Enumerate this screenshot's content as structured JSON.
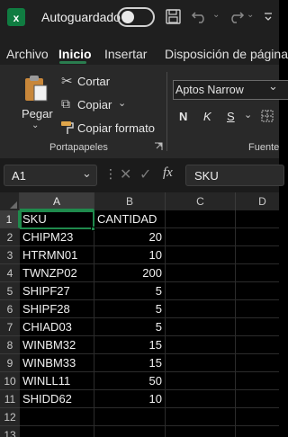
{
  "titlebar": {
    "autosave_label": "Autoguardado",
    "autosave_state": "off"
  },
  "tabs": [
    "Archivo",
    "Inicio",
    "Insertar",
    "Disposición de página"
  ],
  "active_tab": "Inicio",
  "ribbon": {
    "paste_label": "Pegar",
    "cut_label": "Cortar",
    "copy_label": "Copiar",
    "format_painter_label": "Copiar formato",
    "clipboard_group": "Portapapeles",
    "font_name": "Aptos Narrow",
    "bold": "N",
    "italic": "K",
    "underline": "S",
    "font_group": "Fuente"
  },
  "formula_bar": {
    "name_box": "A1",
    "fx": "fx",
    "value": "SKU"
  },
  "grid": {
    "columns": [
      "A",
      "B",
      "C",
      "D"
    ],
    "rows": [
      {
        "num": "1",
        "a": "SKU",
        "b": "CANTIDAD",
        "b_text": true
      },
      {
        "num": "2",
        "a": "CHIPM23",
        "b": "20"
      },
      {
        "num": "3",
        "a": "HTRMN01",
        "b": "10"
      },
      {
        "num": "4",
        "a": "TWNZP02",
        "b": "200"
      },
      {
        "num": "5",
        "a": "SHIPF27",
        "b": "5"
      },
      {
        "num": "6",
        "a": "SHIPF28",
        "b": "5"
      },
      {
        "num": "7",
        "a": "CHIAD03",
        "b": "5"
      },
      {
        "num": "8",
        "a": "WINBM32",
        "b": "15"
      },
      {
        "num": "9",
        "a": "WINBM33",
        "b": "15"
      },
      {
        "num": "10",
        "a": "WINLL11",
        "b": "50"
      },
      {
        "num": "11",
        "a": "SHIDD62",
        "b": "10"
      },
      {
        "num": "12",
        "a": "",
        "b": ""
      },
      {
        "num": "13",
        "a": "",
        "b": ""
      }
    ]
  },
  "colors": {
    "accent": "#1f8a4c",
    "excel_green": "#107c41"
  }
}
